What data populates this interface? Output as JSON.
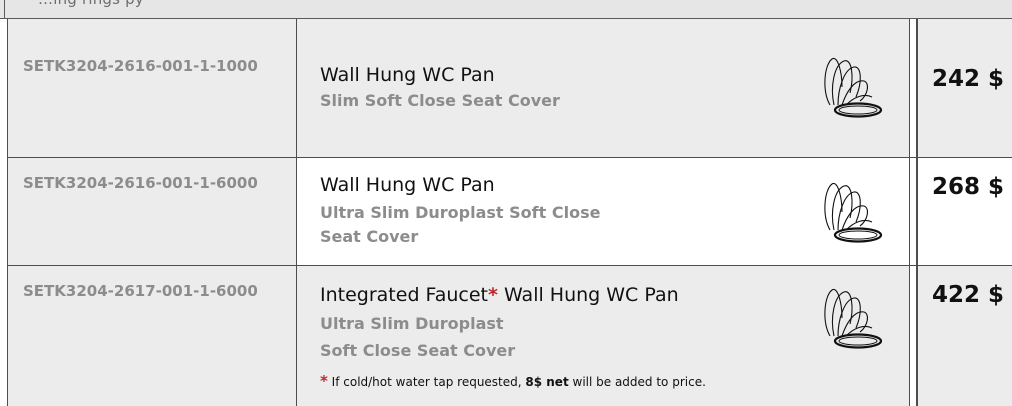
{
  "header_clipped_text": "…ing  rings      py    ",
  "rows": [
    {
      "code": "SETK3204-2616-001-1-1000",
      "title": "Wall Hung WC Pan",
      "subtitle_lines": [
        "Slim Soft Close Seat Cover"
      ],
      "price": "242 $",
      "icon": "toilet-seat-cover-icon"
    },
    {
      "code": "SETK3204-2616-001-1-6000",
      "title": "Wall Hung WC Pan",
      "subtitle_lines": [
        "Ultra Slim Duroplast Soft Close",
        "Seat Cover"
      ],
      "price": "268 $",
      "icon": "toilet-seat-cover-icon"
    },
    {
      "code": "SETK3204-2617-001-1-6000",
      "title_prefix": "Integrated Faucet",
      "title_star": "*",
      "title_suffix": " Wall Hung WC Pan",
      "subtitle_lines": [
        "Ultra Slim Duroplast",
        "Soft Close Seat Cover"
      ],
      "note_star": "*",
      "note_before": " If cold/hot water tap requested, ",
      "note_bold": "8$ net",
      "note_after": " will be added to price.",
      "price": "422 $",
      "icon": "toilet-seat-cover-icon"
    }
  ],
  "colors": {
    "shaded_bg": "#ececec",
    "border": "#4d4d4d",
    "code_grey": "#8c8c8c",
    "accent_red": "#c0272d"
  }
}
